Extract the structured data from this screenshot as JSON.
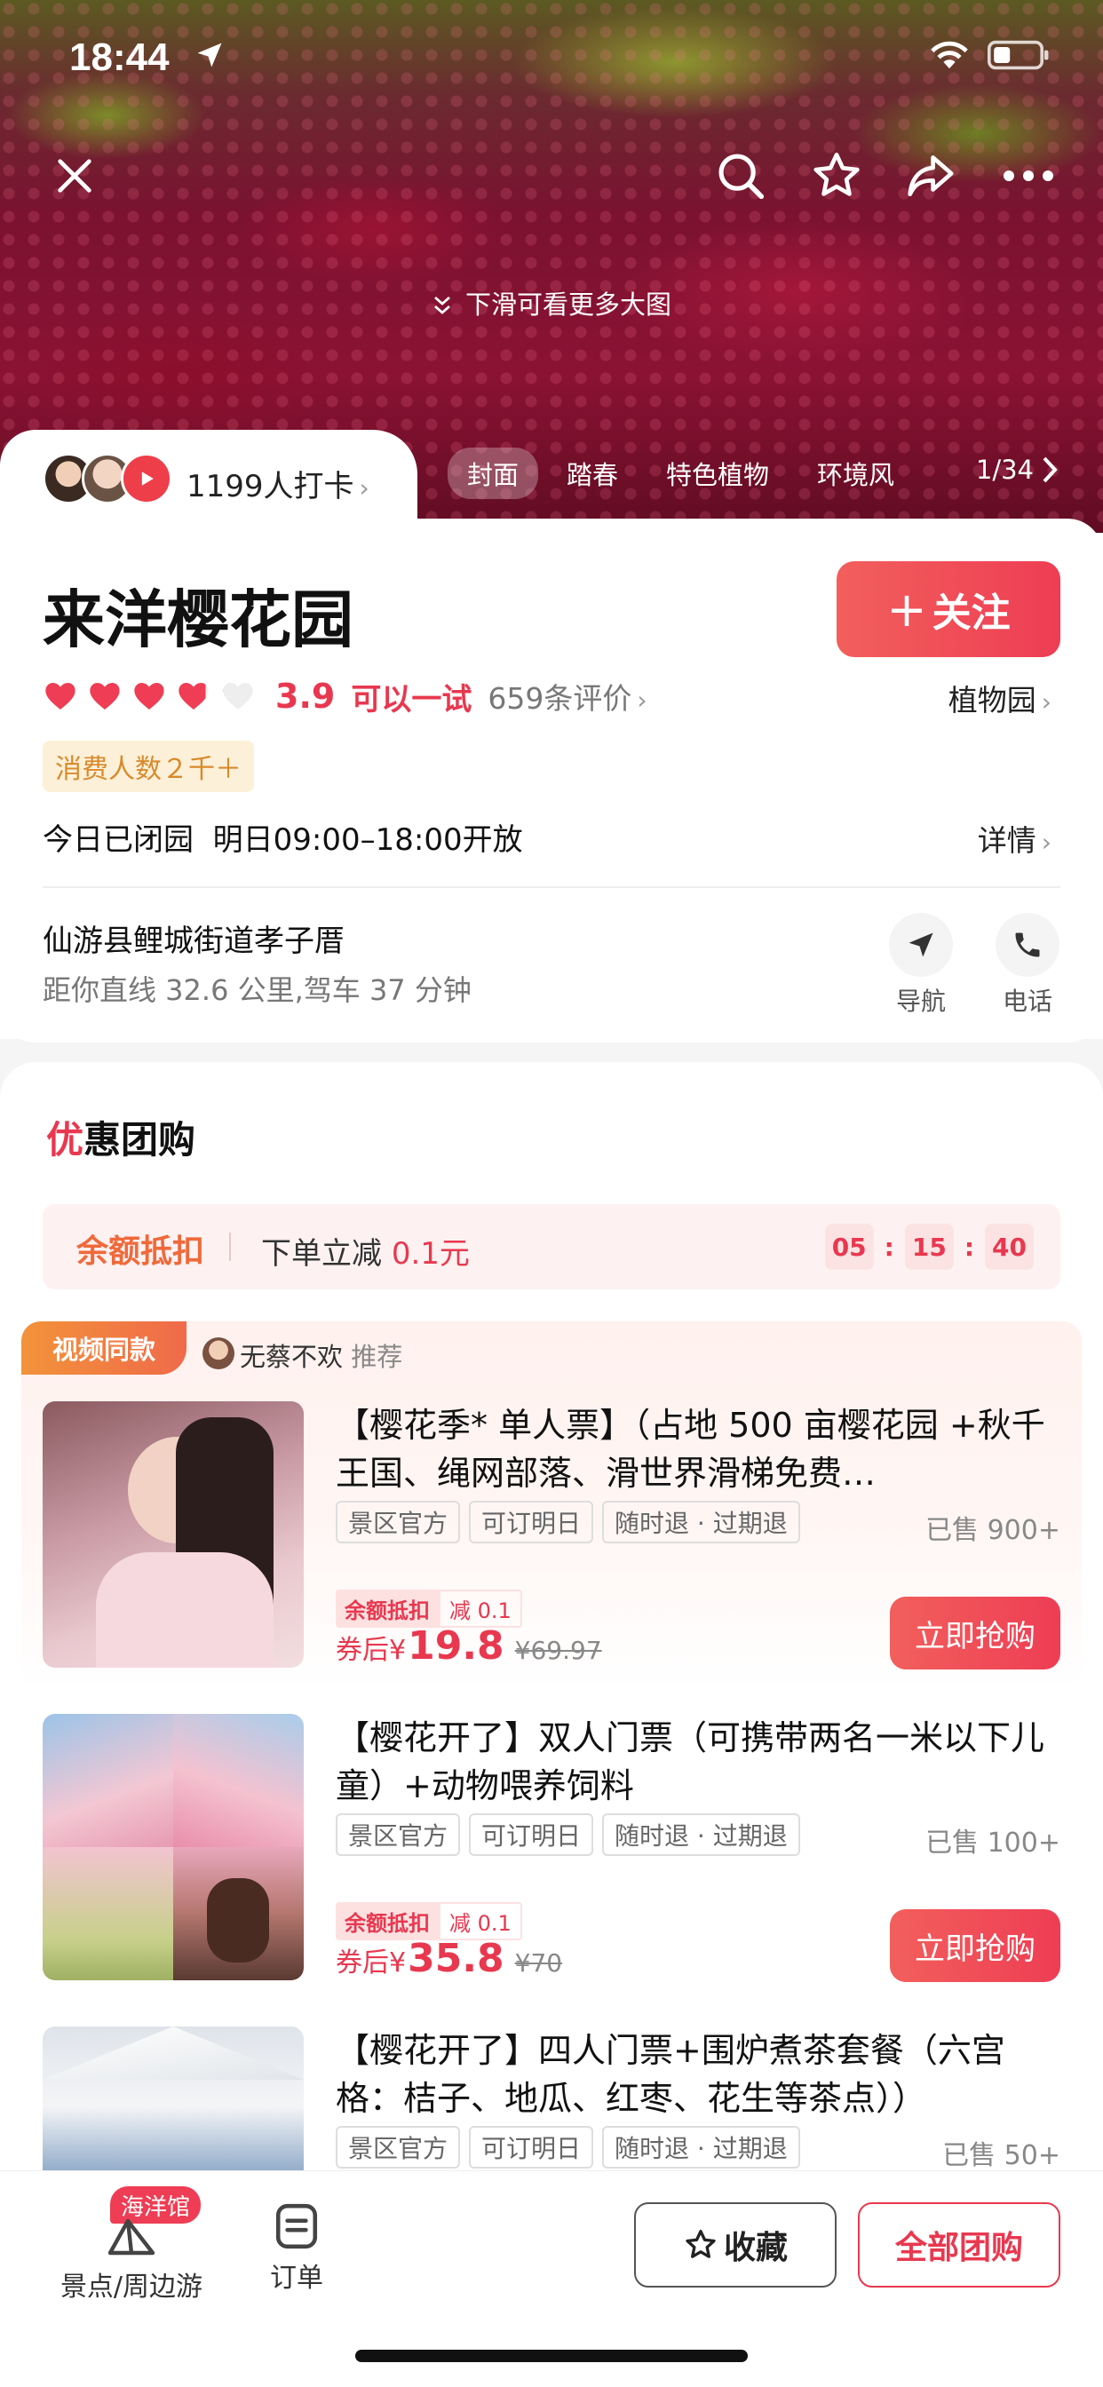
{
  "status_bar": {
    "time": "18:44"
  },
  "hero": {
    "hint": "下滑可看更多大图",
    "checkin": "1199人打卡",
    "tabs": [
      "封面",
      "踏春",
      "特色植物",
      "环境风光"
    ],
    "page_indicator": "1/34"
  },
  "place": {
    "name": "来洋樱花园",
    "follow_label": "关注",
    "rating": {
      "hearts_filled_fraction": 0.78,
      "score": "3.9",
      "verdict": "可以一试",
      "reviews": "659条评价"
    },
    "category": "植物园",
    "consume_badge": "消费人数２千＋",
    "hours": "今日已闭园  明日09:00–18:00开放",
    "hours_detail": "详情",
    "address": "仙游县鲤城街道孝子厝",
    "distance": "距你直线 32.6 公里,驾车 37 分钟",
    "actions": {
      "navigate": "导航",
      "call": "电话"
    }
  },
  "deals": {
    "title_first": "优",
    "title_rest": "惠团购",
    "promo": {
      "label": "余额抵扣",
      "text": "下单立减",
      "amount": "0.1元",
      "timer": [
        "05",
        "15",
        "40"
      ]
    },
    "video_tag": "视频同款",
    "recommender": "无蔡不欢",
    "recommend_word": "推荐",
    "products": [
      {
        "title": "【樱花季* 单人票】（占地 500 亩樱花园 +秋千王国、绳网部落、滑世界滑梯免费…",
        "tags": [
          "景区官方",
          "可订明日",
          "随时退 · 过期退"
        ],
        "sold": "已售 900+",
        "discount_label": "余额抵扣",
        "discount_value": "减 0.1",
        "price_prefix": "券后¥",
        "price": "19.8",
        "original": "¥69.97",
        "buy_label": "立即抢购"
      },
      {
        "title": "【樱花开了】双人门票（可携带两名一米以下儿童）+动物喂养饲料",
        "tags": [
          "景区官方",
          "可订明日",
          "随时退 · 过期退"
        ],
        "sold": "已售 100+",
        "discount_label": "余额抵扣",
        "discount_value": "减 0.1",
        "price_prefix": "券后¥",
        "price": "35.8",
        "original": "¥70",
        "buy_label": "立即抢购"
      },
      {
        "title": "【樱花开了】四人门票+围炉煮茶套餐（六宫格：桔子、地瓜、红枣、花生等茶点））",
        "tags": [
          "景区官方",
          "可订明日",
          "随时退 · 过期退"
        ],
        "sold": "已售 50+"
      }
    ]
  },
  "bottom_bar": {
    "ocean_badge": "海洋馆",
    "nav_spots": "景点/周边游",
    "nav_orders": "订单",
    "favorite": "收藏",
    "all_deals": "全部团购"
  },
  "colors": {
    "accent": "#e8384f",
    "orange": "#f0693a",
    "badge_bg": "#fdf0d8"
  }
}
